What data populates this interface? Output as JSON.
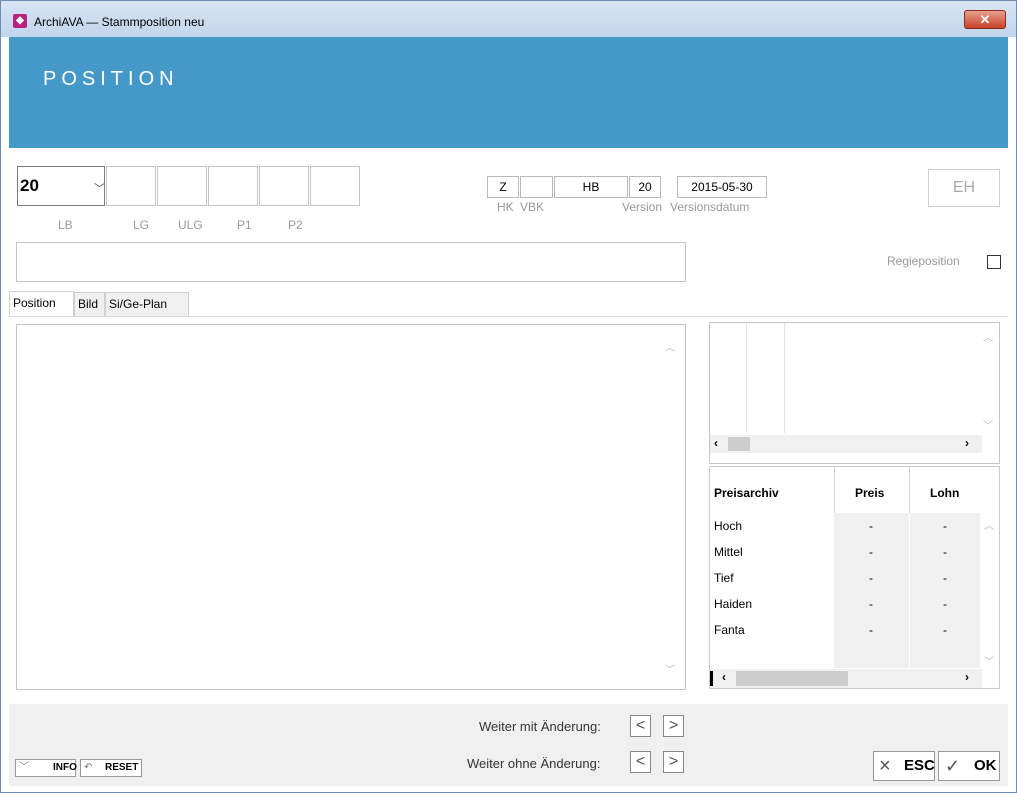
{
  "window": {
    "title": "ArchiAVA — Stammposition neu",
    "close_glyph": "✕"
  },
  "header": {
    "heading": "POSITION"
  },
  "fields": {
    "lb_value": "20",
    "lb_label": "LB",
    "lg_label": "LG",
    "ulg_label": "ULG",
    "p1_label": "P1",
    "p2_label": "P2",
    "hk_value": "Z",
    "hk_label": "HK",
    "vbk_value": "",
    "vbk_label": "VBK",
    "hb_value": "HB",
    "version_value": "20",
    "version_label": "Version",
    "versionsdatum_value": "2015-05-30",
    "versionsdatum_label": "Versionsdatum",
    "eh_label": "EH",
    "regieposition_label": "Regieposition",
    "regieposition_checked": false
  },
  "tabs": [
    {
      "label": "Position",
      "active": true
    },
    {
      "label": "Bild",
      "active": false
    },
    {
      "label": "Si/Ge-Plan",
      "active": false
    }
  ],
  "price_table": {
    "headers": [
      "Preisarchiv",
      "Preis",
      "Lohn"
    ],
    "rows": [
      {
        "name": "Hoch",
        "preis": "-",
        "lohn": "-"
      },
      {
        "name": "Mittel",
        "preis": "-",
        "lohn": "-"
      },
      {
        "name": "Tief",
        "preis": "-",
        "lohn": "-"
      },
      {
        "name": "Haiden",
        "preis": "-",
        "lohn": "-"
      },
      {
        "name": "Fanta",
        "preis": "-",
        "lohn": "-"
      }
    ]
  },
  "footer": {
    "weiter_mit_label": "Weiter mit Änderung:",
    "weiter_ohne_label": "Weiter ohne Änderung:",
    "info_label": "INFO",
    "reset_label": "RESET",
    "esc_label": "ESC",
    "ok_label": "OK"
  },
  "colors": {
    "header_band": "#4599c9",
    "close_button": "#c7432a",
    "app_icon": "#b8227e"
  },
  "icons": {
    "app": "archiava-logo-icon",
    "close": "close-icon",
    "dropdown": "chevron-down-icon",
    "prev": "chevron-left-icon",
    "next": "chevron-right-icon",
    "esc": "x-icon",
    "ok": "check-icon",
    "info": "chevron-down-icon",
    "reset": "undo-arrow-icon"
  }
}
